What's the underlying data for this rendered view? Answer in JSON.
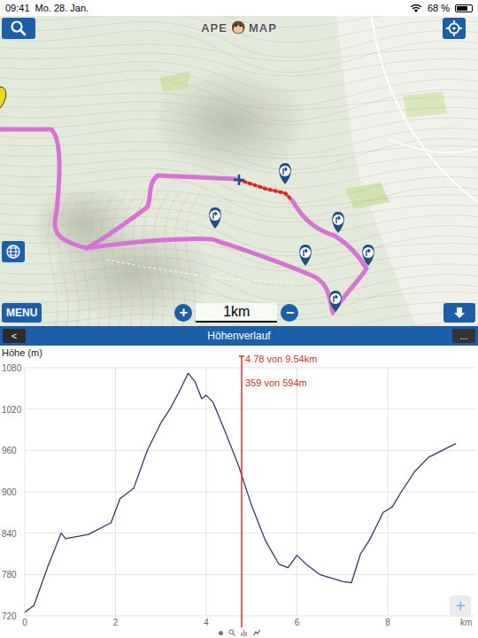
{
  "status_bar": {
    "time": "09:41",
    "date": "Mo. 28. Jan.",
    "battery": "68 %",
    "battery_level": 0.68
  },
  "app": {
    "logo_left": "APE",
    "logo_right": "MAP"
  },
  "map": {
    "menu_button": "MENU",
    "scale": "1km",
    "zoom_in": "+",
    "zoom_out": "−"
  },
  "panel": {
    "back": "<",
    "title": "Höhenverlauf",
    "more": "..."
  },
  "chart": {
    "y_label": "Höhe (m)",
    "y_ticks": [
      "1080",
      "1020",
      "960",
      "900",
      "840",
      "780",
      "720"
    ],
    "x_ticks": [
      "0",
      "2",
      "4",
      "6",
      "8"
    ],
    "x_unit": "km",
    "series": [
      {
        "name": "elevation",
        "distance_km": [
          0,
          0.2,
          0.5,
          0.8,
          0.9,
          1.4,
          1.9,
          2.1,
          2.4,
          2.7,
          3.0,
          3.2,
          3.4,
          3.6,
          3.75,
          3.9,
          4.0,
          4.15,
          4.4,
          4.7,
          5.0,
          5.3,
          5.6,
          5.8,
          6.0,
          6.2,
          6.5,
          7.0,
          7.2,
          7.4,
          7.6,
          7.9,
          8.1,
          8.3,
          8.6,
          8.9,
          9.2,
          9.5
        ],
        "elevation_m": [
          725,
          735,
          790,
          840,
          832,
          838,
          855,
          890,
          905,
          960,
          1000,
          1020,
          1045,
          1072,
          1060,
          1035,
          1040,
          1030,
          990,
          940,
          880,
          830,
          795,
          790,
          808,
          795,
          780,
          770,
          768,
          810,
          830,
          870,
          878,
          900,
          930,
          950,
          960,
          970
        ]
      }
    ],
    "cursor": {
      "distance_km": 4.78,
      "distance_label": "4.78 von 9.54km",
      "point_label": "359 von 594m"
    },
    "add_button": "+"
  }
}
